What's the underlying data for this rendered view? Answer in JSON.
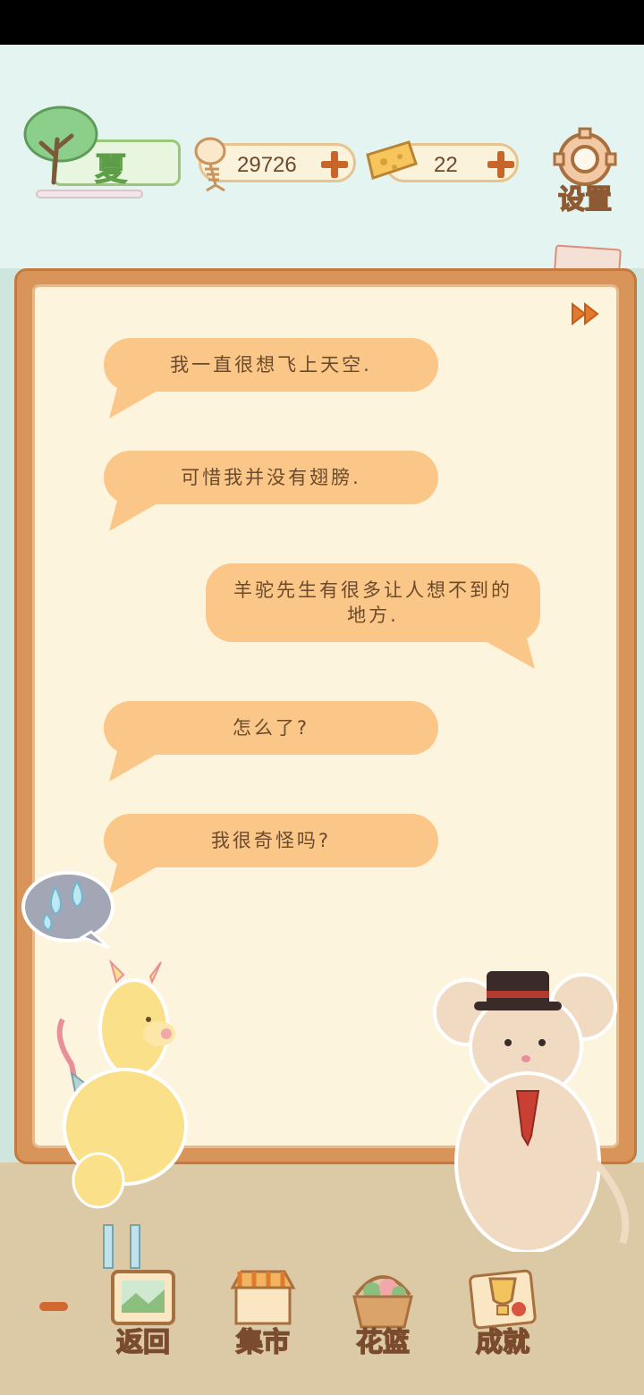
{
  "header": {
    "season_label": "夏",
    "fish_count": "29726",
    "cheese_count": "22",
    "settings_label": "设置"
  },
  "dialog": {
    "lines": [
      {
        "speaker": "left",
        "text": "我一直很想飞上天空."
      },
      {
        "speaker": "left",
        "text": "可惜我并没有翅膀."
      },
      {
        "speaker": "right",
        "text": "羊驼先生有很多让人想不到的地方."
      },
      {
        "speaker": "left",
        "text": "怎么了?"
      },
      {
        "speaker": "left",
        "text": "我很奇怪吗?"
      }
    ]
  },
  "nav": {
    "back_label": "返回",
    "market_label": "集市",
    "basket_label": "花篮",
    "achieve_label": "成就"
  },
  "colors": {
    "bubble": "#fbc788",
    "board": "#d9945a",
    "accent_plus": "#c8652a"
  }
}
